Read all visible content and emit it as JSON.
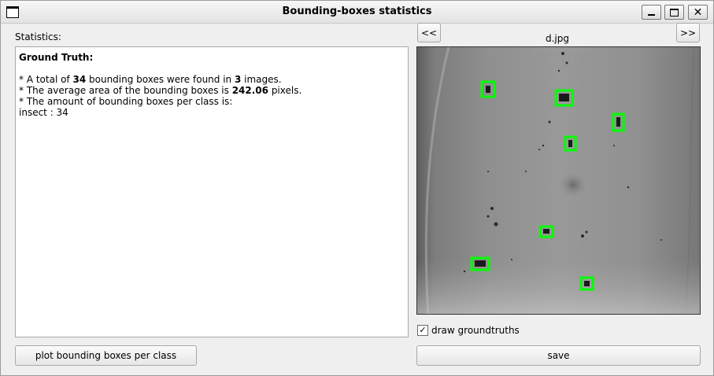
{
  "window": {
    "title": "Bounding-boxes statistics",
    "icons": {
      "system": "window-icon",
      "minimize": "minimize-icon",
      "maximize": "maximize-icon",
      "close": "close-icon"
    }
  },
  "stats": {
    "label": "Statistics:",
    "heading": "Ground Truth:",
    "line1": {
      "pre": "* A total of ",
      "boxes": "34",
      "mid": " bounding boxes were found in ",
      "images": "3",
      "post": " images."
    },
    "line2": {
      "pre": "* The average area of the bounding boxes is ",
      "area": "242.06",
      "post": " pixels."
    },
    "line3": "* The amount of bounding boxes per class is:",
    "class_line": "insect : 34"
  },
  "buttons": {
    "plot": "plot bounding boxes per class",
    "prev": "<<",
    "next": ">>",
    "save": "save"
  },
  "image": {
    "filename": "d.jpg",
    "box_color": "#00ff00",
    "box_count_shown": 7
  },
  "options": {
    "draw_groundtruths_label": "draw groundtruths",
    "draw_groundtruths_checked": true,
    "check_glyph": "✓"
  }
}
